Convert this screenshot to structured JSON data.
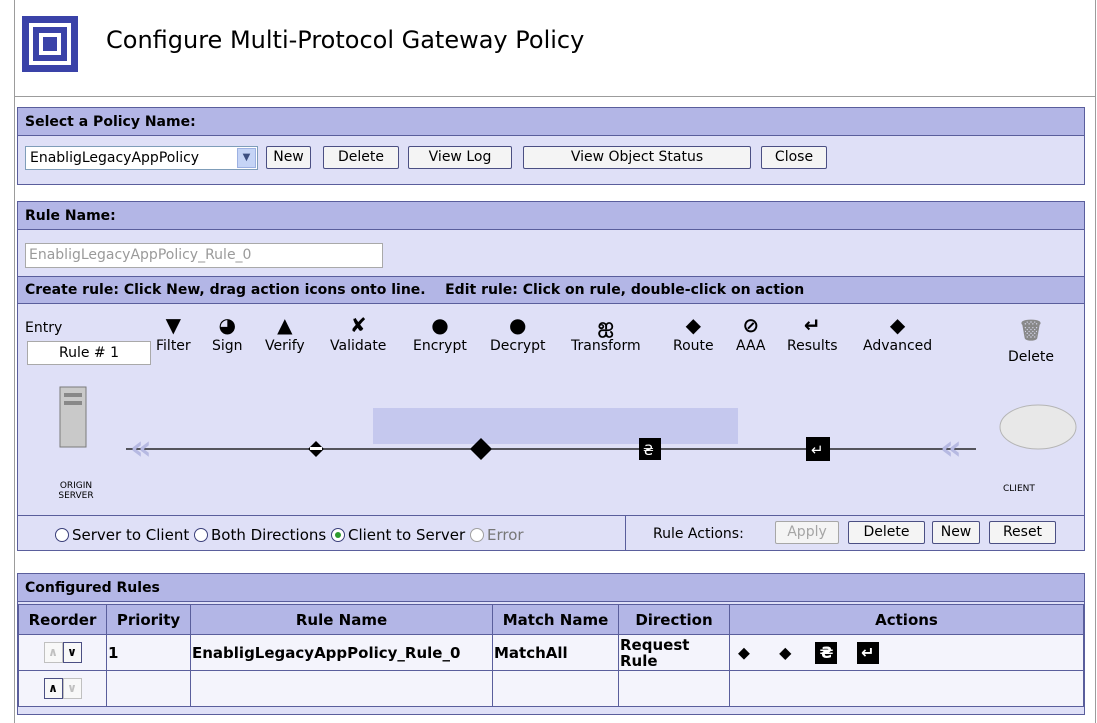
{
  "header": {
    "title": "Configure Multi-Protocol Gateway Policy",
    "logo_icon": "nested-squares-icon"
  },
  "policy_panel": {
    "heading": "Select a Policy Name:",
    "selected_policy": "EnabligLegacyAppPolicy",
    "buttons": {
      "new": "New",
      "delete": "Delete",
      "view_log": "View Log",
      "view_object_status": "View Object Status",
      "close": "Close"
    }
  },
  "rule_panel": {
    "heading": "Rule Name:",
    "rule_name_value": "EnabligLegacyAppPolicy_Rule_0",
    "instructions": "Create rule: Click New, drag action icons onto line.    Edit rule: Click on rule, double-click on action",
    "entry_label": "Entry",
    "entry_value": "Rule # 1",
    "actions": [
      {
        "label": "Filter",
        "icon": "filter-icon",
        "glyph": "▼"
      },
      {
        "label": "Sign",
        "icon": "sign-icon",
        "glyph": "●"
      },
      {
        "label": "Verify",
        "icon": "verify-icon",
        "glyph": "▲"
      },
      {
        "label": "Validate",
        "icon": "validate-icon",
        "glyph": "✗"
      },
      {
        "label": "Encrypt",
        "icon": "encrypt-icon",
        "glyph": "🔒"
      },
      {
        "label": "Decrypt",
        "icon": "decrypt-icon",
        "glyph": "🔓"
      },
      {
        "label": "Transform",
        "icon": "transform-icon",
        "glyph": "₴"
      },
      {
        "label": "Route",
        "icon": "route-icon",
        "glyph": "◆"
      },
      {
        "label": "AAA",
        "icon": "aaa-icon",
        "glyph": "⊘"
      },
      {
        "label": "Results",
        "icon": "results-icon",
        "glyph": "↵"
      },
      {
        "label": "Advanced",
        "icon": "advanced-icon",
        "glyph": "◆"
      }
    ],
    "delete_label": "Delete",
    "origin_server_label": "ORIGIN\nSERVER",
    "client_label": "CLIENT",
    "directions": [
      "Server to Client",
      "Both Directions",
      "Client to Server",
      "Error"
    ],
    "selected_direction": "Client to Server",
    "rule_actions_label": "Rule Actions:",
    "rule_action_buttons": {
      "apply": "Apply",
      "delete": "Delete",
      "new": "New",
      "reset": "Reset"
    }
  },
  "configured_rules": {
    "heading": "Configured Rules",
    "columns": [
      "Reorder",
      "Priority",
      "Rule Name",
      "Match Name",
      "Direction",
      "Actions"
    ],
    "rows": [
      {
        "priority": "1",
        "rule_name": "EnabligLegacyAppPolicy_Rule_0",
        "match_name": "MatchAll",
        "direction": "Request Rule"
      },
      {
        "priority": "",
        "rule_name": "",
        "match_name": "",
        "direction": ""
      }
    ]
  },
  "colors": {
    "panel_bg": "#dfe0f7",
    "panel_header": "#b3b6e6",
    "border": "#5a5e9c",
    "logo_blue": "#3a42a8"
  }
}
